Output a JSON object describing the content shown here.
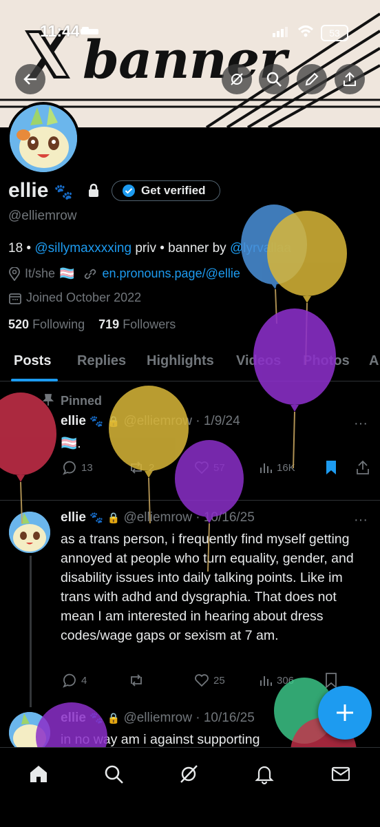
{
  "status_bar": {
    "time": "11:44",
    "battery": "53"
  },
  "banner": {
    "text": "banner"
  },
  "profile": {
    "display_name": "ellie",
    "paw": "🐾",
    "verify_label": "Get verified",
    "username": "@elliemrow",
    "bio_prefix": "18 • ",
    "bio_mention": "@sillymaxxxxing",
    "bio_middle": " priv • banner by ",
    "bio_credit": "@lyrvallaa",
    "pronouns": "It/she",
    "flag": "🏳️‍⚧️",
    "website": "en.pronouns.page/@ellie",
    "joined": "Joined October 2022",
    "following_count": "520",
    "following_label": "Following",
    "followers_count": "719",
    "followers_label": "Followers"
  },
  "tabs": [
    {
      "label": "Posts"
    },
    {
      "label": "Replies"
    },
    {
      "label": "Highlights"
    },
    {
      "label": "Videos"
    },
    {
      "label": "Photos"
    },
    {
      "label": "A"
    }
  ],
  "posts": [
    {
      "pinned_label": "Pinned",
      "name": "ellie",
      "handle": "@elliemrow",
      "date": "· 1/9/24",
      "text": "🏳️‍⚧️.",
      "replies": "13",
      "reposts": "2",
      "likes": "57",
      "views": "16K"
    },
    {
      "name": "ellie",
      "handle": "@elliemrow",
      "date": "· 10/16/25",
      "text": "as a trans person, i frequently find myself getting annoyed at people who turn equality, gender, and disability issues into daily talking points. Like im trans with adhd and dysgraphia. That does not mean I am interested in hearing about dress codes/wage gaps or sexism at 7 am.",
      "replies": "4",
      "reposts": "",
      "likes": "25",
      "views": "306"
    },
    {
      "name": "ellie",
      "handle": "@elliemrow",
      "date": "· 10/16/25",
      "text": "in no way am i against  supporting"
    }
  ],
  "colors": {
    "accent": "#1d9bf0",
    "background": "#000000",
    "muted": "#71767b",
    "border": "#2f3336"
  }
}
